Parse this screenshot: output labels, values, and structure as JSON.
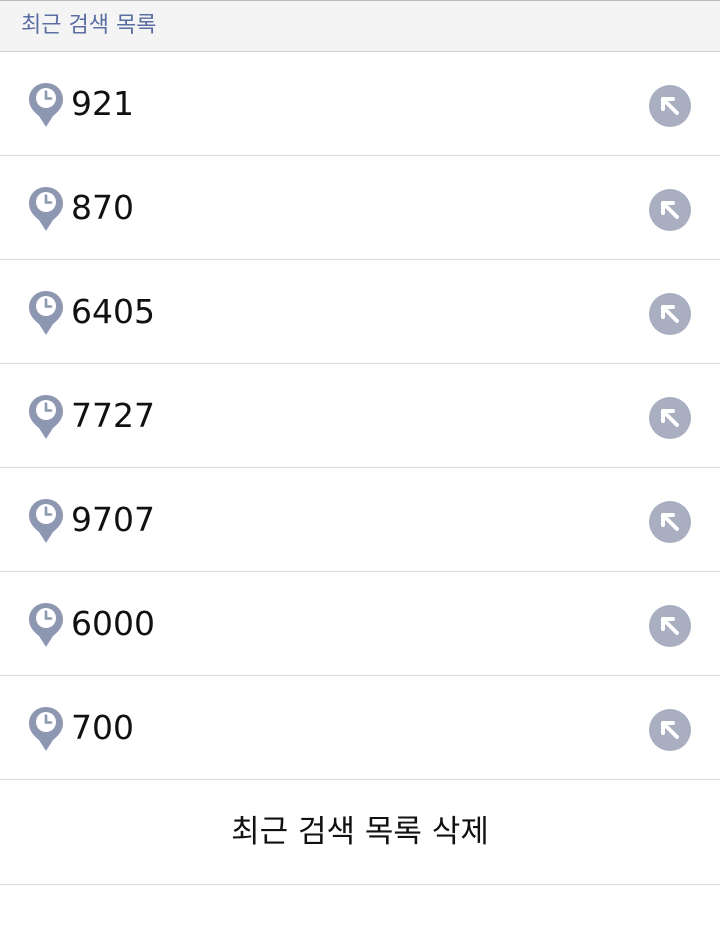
{
  "header": {
    "title": "최근 검색 목록"
  },
  "recent_items": [
    {
      "label": "921",
      "icon": "clock-pin-icon",
      "action_icon": "arrow-up-left-icon"
    },
    {
      "label": "870",
      "icon": "clock-pin-icon",
      "action_icon": "arrow-up-left-icon"
    },
    {
      "label": "6405",
      "icon": "clock-pin-icon",
      "action_icon": "arrow-up-left-icon"
    },
    {
      "label": "7727",
      "icon": "clock-pin-icon",
      "action_icon": "arrow-up-left-icon"
    },
    {
      "label": "9707",
      "icon": "clock-pin-icon",
      "action_icon": "arrow-up-left-icon"
    },
    {
      "label": "6000",
      "icon": "clock-pin-icon",
      "action_icon": "arrow-up-left-icon"
    },
    {
      "label": "700",
      "icon": "clock-pin-icon",
      "action_icon": "arrow-up-left-icon"
    }
  ],
  "footer": {
    "delete_label": "최근 검색 목록 삭제"
  },
  "colors": {
    "header_text": "#5a6ea4",
    "pin": "#8e97b1",
    "arrow_button": "#a9aec0"
  }
}
